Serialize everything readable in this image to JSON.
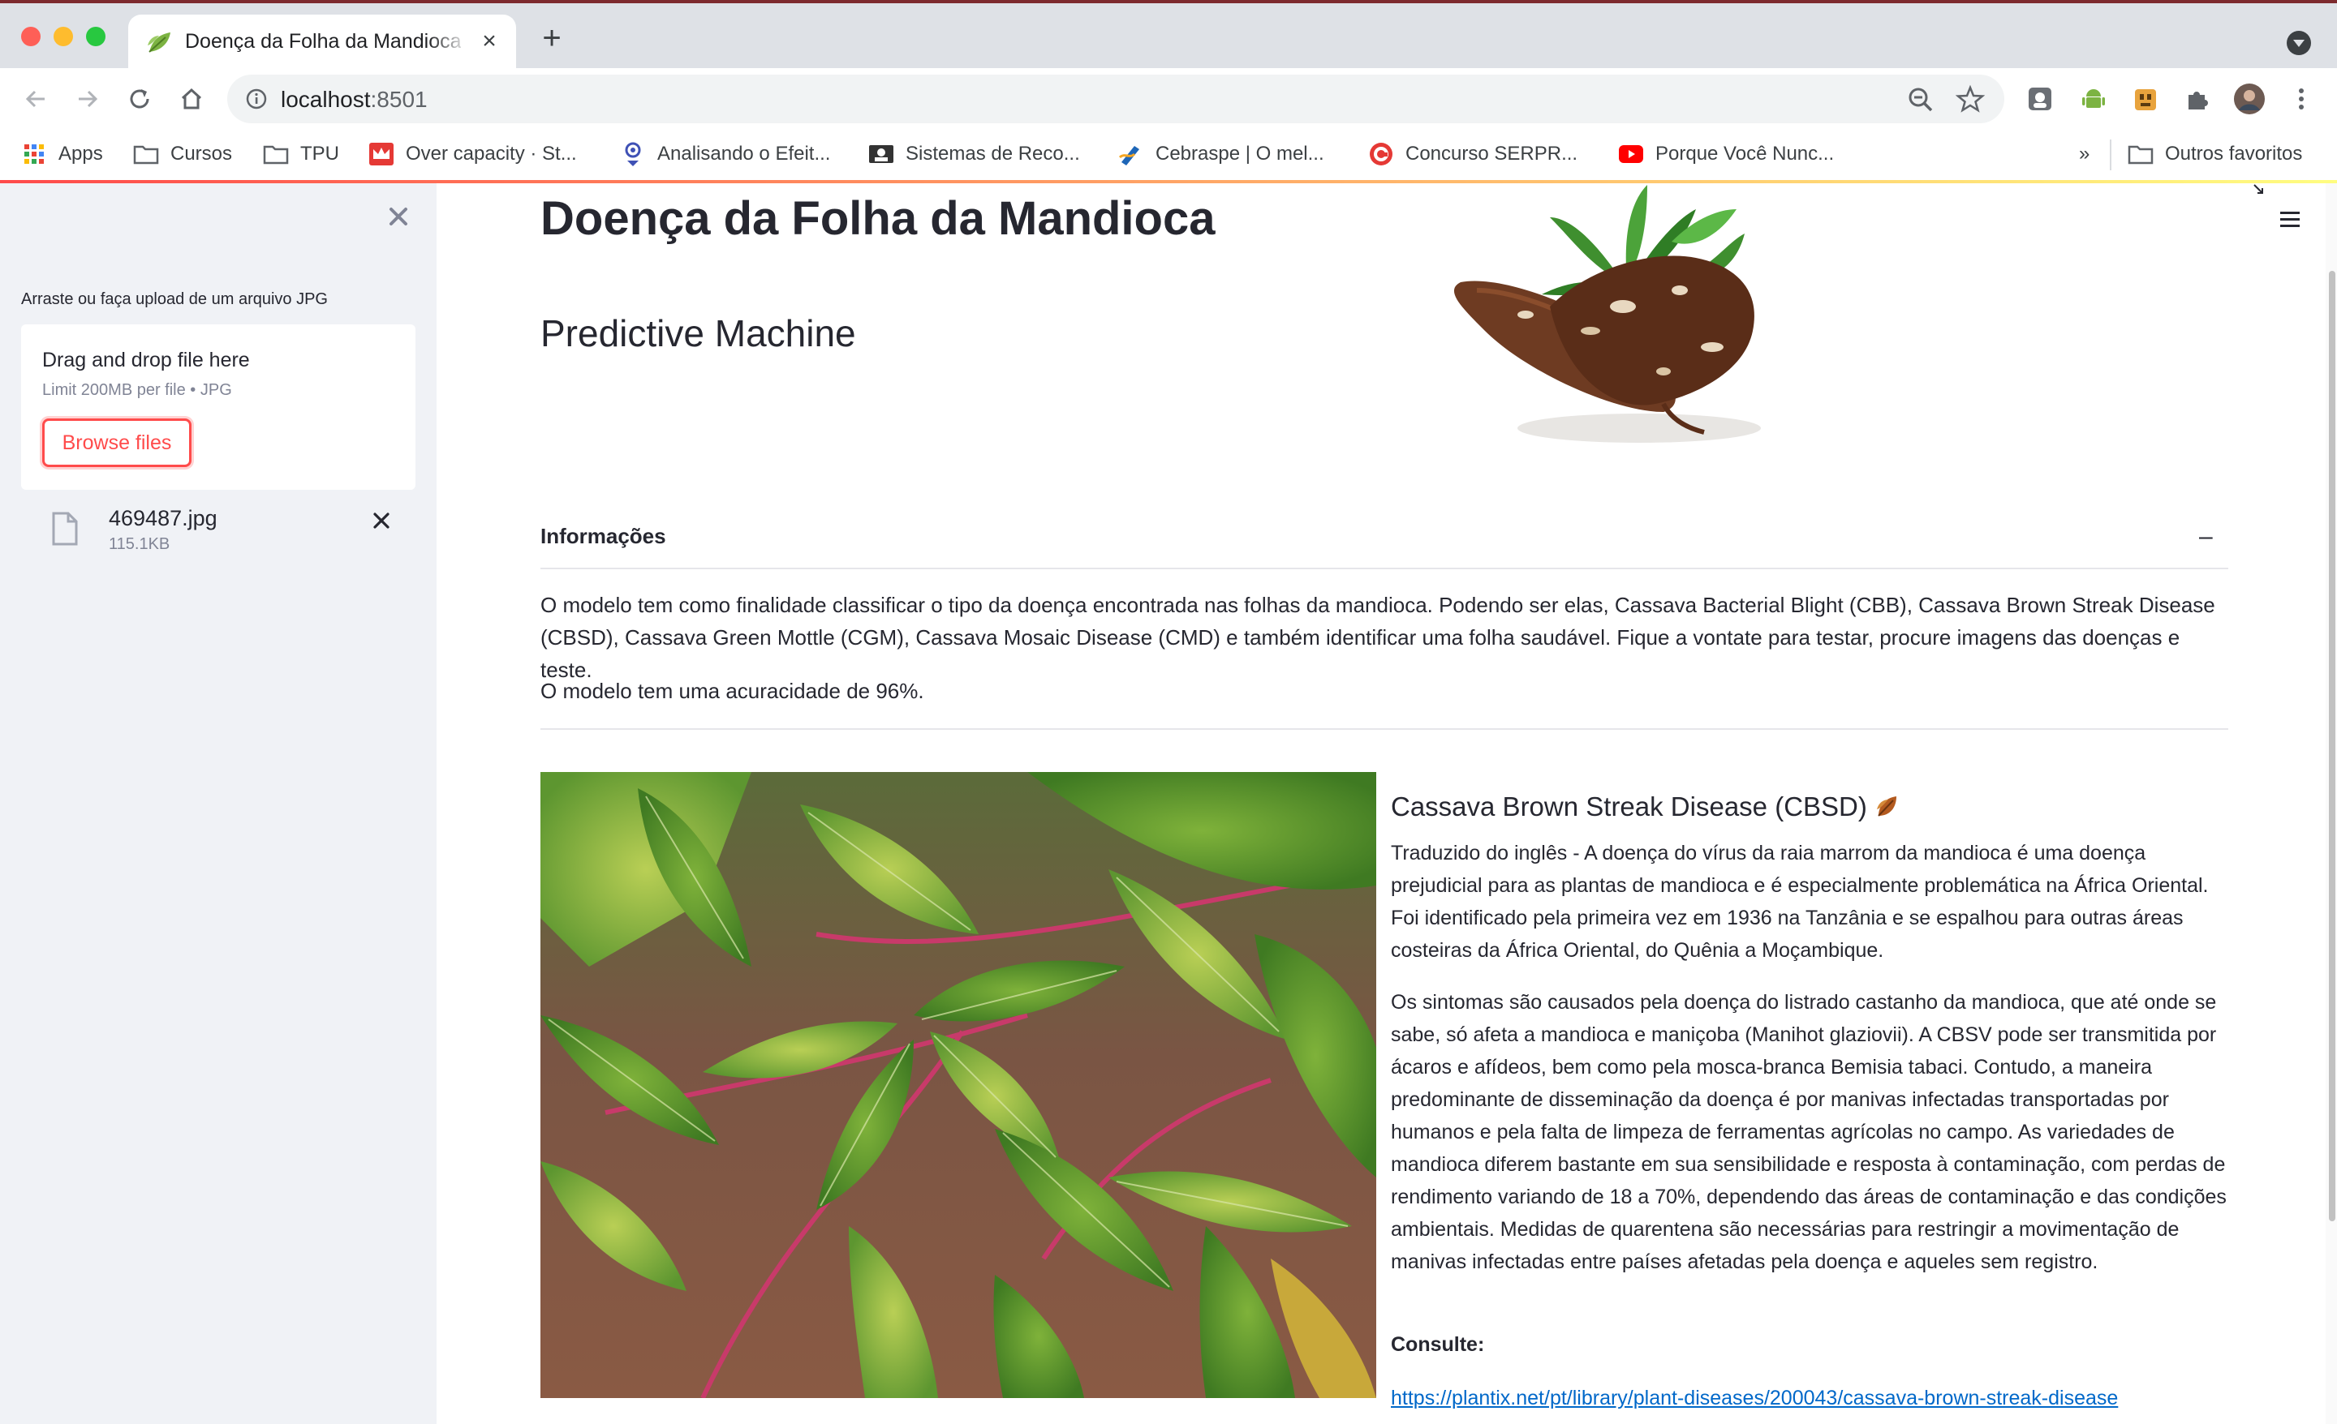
{
  "browser": {
    "tab_title": "Doença da Folha da Mandioca",
    "new_tab": "+",
    "url_host": "localhost",
    "url_port": ":8501"
  },
  "bookmarks": [
    {
      "label": "Apps",
      "icon": "apps-grid-icon"
    },
    {
      "label": "Cursos",
      "icon": "folder-icon"
    },
    {
      "label": "TPU",
      "icon": "folder-icon"
    },
    {
      "label": "Over capacity · St...",
      "icon": "crown-icon"
    },
    {
      "label": "Analisando o Efeit...",
      "icon": "site-icon"
    },
    {
      "label": "Sistemas de Reco...",
      "icon": "badge-icon"
    },
    {
      "label": "Cebraspe | O mel...",
      "icon": "pen-icon"
    },
    {
      "label": "Concurso SERPR...",
      "icon": "g-icon"
    },
    {
      "label": "Porque Você Nunc...",
      "icon": "youtube-icon"
    }
  ],
  "bookmarks_more": "»",
  "bookmarks_other": "Outros favoritos",
  "sidebar": {
    "upload_label": "Arraste ou faça upload de um arquivo JPG",
    "dropzone_title": "Drag and drop file here",
    "dropzone_limit": "Limit 200MB per file • JPG",
    "browse_button": "Browse files",
    "file_name": "469487.jpg",
    "file_size": "115.1KB"
  },
  "main": {
    "title": "Doença da Folha da Mandioca",
    "subtitle": "Predictive Machine",
    "expander_title": "Informações",
    "expander_toggle": "–",
    "info_paragraph": "O modelo tem como finalidade classificar o tipo da doença encontrada nas folhas da mandioca. Podendo ser elas, Cassava Bacterial Blight (CBB), Cassava Brown Streak Disease (CBSD), Cassava Green Mottle (CGM), Cassava Mosaic Disease (CMD) e também identificar uma folha saudável. Fique a vontate para testar, procure imagens das doenças e teste.",
    "accuracy": "O modelo tem uma acuracidade de 96%.",
    "disease_title": "Cassava Brown Streak Disease (CBSD)",
    "disease_p1": "Traduzido do inglês - A doença do vírus da raia marrom da mandioca é uma doença prejudicial para as plantas de mandioca e é especialmente problemática na África Oriental. Foi identificado pela primeira vez em 1936 na Tanzânia e se espalhou para outras áreas costeiras da África Oriental, do Quênia a Moçambique.",
    "disease_p2": "Os sintomas são causados pela doença do listrado castanho da mandioca, que até onde se sabe, só afeta a mandioca e maniçoba (Manihot glaziovii). A CBSV pode ser transmitida por ácaros e afídeos, bem como pela mosca-branca Bemisia tabaci. Contudo, a maneira predominante de disseminação da doença é por manivas infectadas transportadas por humanos e pela falta de limpeza de ferramentas agrícolas no campo. As variedades de mandioca diferem bastante em sua sensibilidade e resposta à contaminação, com perdas de rendimento variando de 18 a 70%, dependendo das áreas de contaminação e das condições ambientais. Medidas de quarentena são necessárias para restringir a movimentação de manivas infectadas entre países afetadas pela doença e aqueles sem registro.",
    "consulte": "Consulte:",
    "link": "https://plantix.net/pt/library/plant-diseases/200043/cassava-brown-streak-disease"
  },
  "colors": {
    "accent": "#ff4b4b",
    "link": "#0068c9",
    "sidebar_bg": "#f0f2f6",
    "text": "#262730"
  }
}
